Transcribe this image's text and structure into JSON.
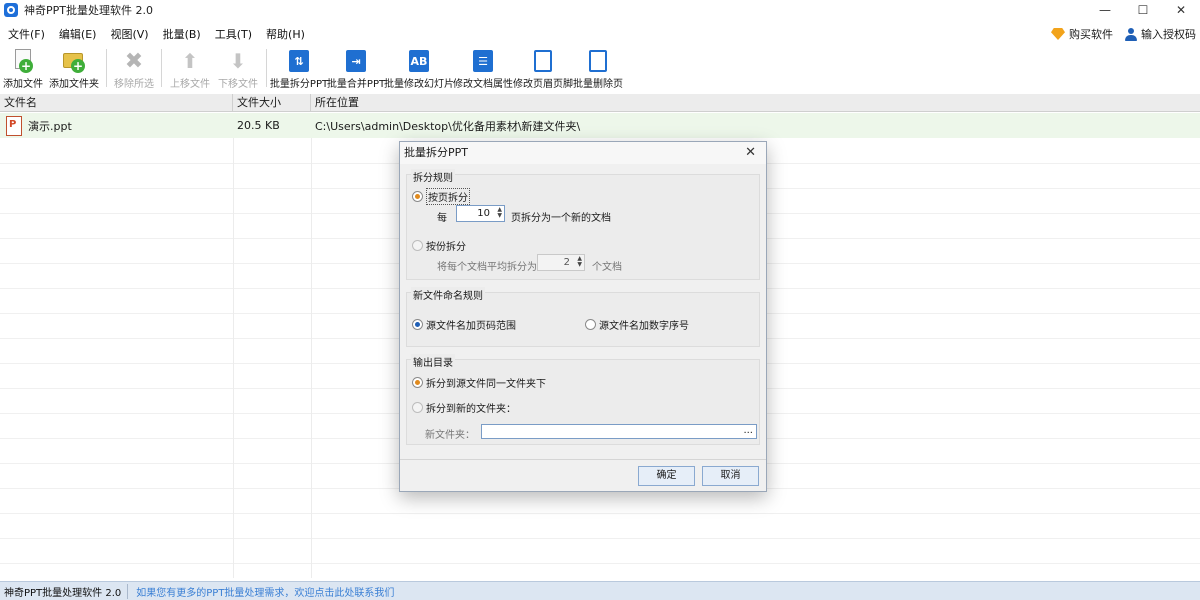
{
  "app": {
    "title": "神奇PPT批量处理软件 2.0",
    "window_buttons": [
      "—",
      "☐",
      "✕"
    ]
  },
  "menu": {
    "items": [
      "文件(F)",
      "编辑(E)",
      "视图(V)",
      "批量(B)",
      "工具(T)",
      "帮助(H)"
    ],
    "buy": "购买软件",
    "license": "输入授权码"
  },
  "toolbar": {
    "add_file": "添加文件",
    "add_folder": "添加文件夹",
    "remove_selected": "移除所选",
    "move_up": "上移文件",
    "move_down": "下移文件",
    "split_ppt": "批量拆分PPT",
    "merge_ppt": "批量合并PPT",
    "modify_slides": "批量修改幻灯片",
    "modify_props": "修改文档属性",
    "modify_header_footer": "修改页眉页脚",
    "delete_pages": "批量删除页"
  },
  "file_list": {
    "columns": [
      "文件名",
      "文件大小",
      "所在位置"
    ],
    "rows": [
      {
        "name": "演示.ppt",
        "size": "20.5 KB",
        "location": "C:\\Users\\admin\\Desktop\\优化备用素材\\新建文件夹\\"
      }
    ]
  },
  "status": {
    "app": "神奇PPT批量处理软件 2.0",
    "link": "如果您有更多的PPT批量处理需求，欢迎点击此处联系我们"
  },
  "dialog": {
    "title": "批量拆分PPT",
    "close": "✕",
    "split_rule": {
      "title": "拆分规则",
      "by_page": "按页拆分",
      "every": "每",
      "pages_value": "10",
      "pages_suffix": "页拆分为一个新的文档",
      "by_count": "按份拆分",
      "count_prefix": "将每个文档平均拆分为",
      "count_value": "2",
      "count_suffix": "个文档"
    },
    "naming": {
      "title": "新文件命名规则",
      "option1": "源文件名加页码范围",
      "option2": "源文件名加数字序号"
    },
    "output": {
      "title": "输出目录",
      "same_folder": "拆分到源文件同一文件夹下",
      "new_folder": "拆分到新的文件夹：",
      "folder_label": "新文件夹：",
      "browse": "..."
    },
    "ok": "确定",
    "cancel": "取消"
  }
}
